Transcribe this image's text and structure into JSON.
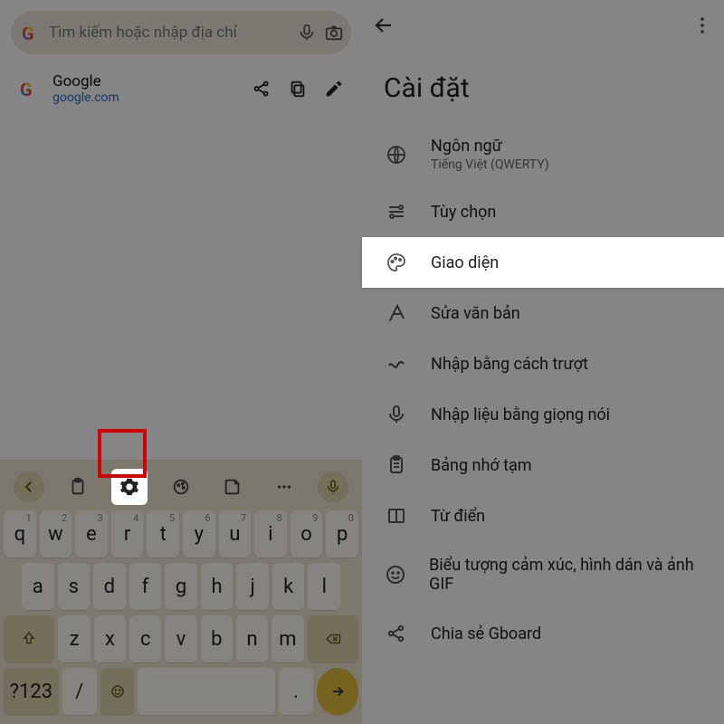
{
  "left": {
    "search_placeholder": "Tìm kiếm hoặc nhập địa chỉ",
    "site": {
      "title": "Google",
      "url": "google.com"
    },
    "keyboard": {
      "row1": [
        {
          "k": "q",
          "h": "1"
        },
        {
          "k": "w",
          "h": "2"
        },
        {
          "k": "e",
          "h": "3"
        },
        {
          "k": "r",
          "h": "4"
        },
        {
          "k": "t",
          "h": "5"
        },
        {
          "k": "y",
          "h": "6"
        },
        {
          "k": "u",
          "h": "7"
        },
        {
          "k": "i",
          "h": "8"
        },
        {
          "k": "o",
          "h": "9"
        },
        {
          "k": "p",
          "h": "0"
        }
      ],
      "row2": [
        "a",
        "s",
        "d",
        "f",
        "g",
        "h",
        "j",
        "k",
        "l"
      ],
      "row3_mid": [
        "z",
        "x",
        "c",
        "v",
        "b",
        "n",
        "m"
      ],
      "symkey": "?123",
      "slash": "/",
      "period": "."
    }
  },
  "right": {
    "title": "Cài đặt",
    "items": [
      {
        "label": "Ngôn ngữ",
        "sub": "Tiếng Việt (QWERTY)"
      },
      {
        "label": "Tùy chọn"
      },
      {
        "label": "Giao diện"
      },
      {
        "label": "Sửa văn bản"
      },
      {
        "label": "Nhập bằng cách trượt"
      },
      {
        "label": "Nhập liệu bằng giọng nói"
      },
      {
        "label": "Bảng nhớ tạm"
      },
      {
        "label": "Từ điển"
      },
      {
        "label": "Biểu tượng cảm xúc, hình dán và ảnh GIF"
      },
      {
        "label": "Chia sẻ Gboard"
      }
    ]
  }
}
